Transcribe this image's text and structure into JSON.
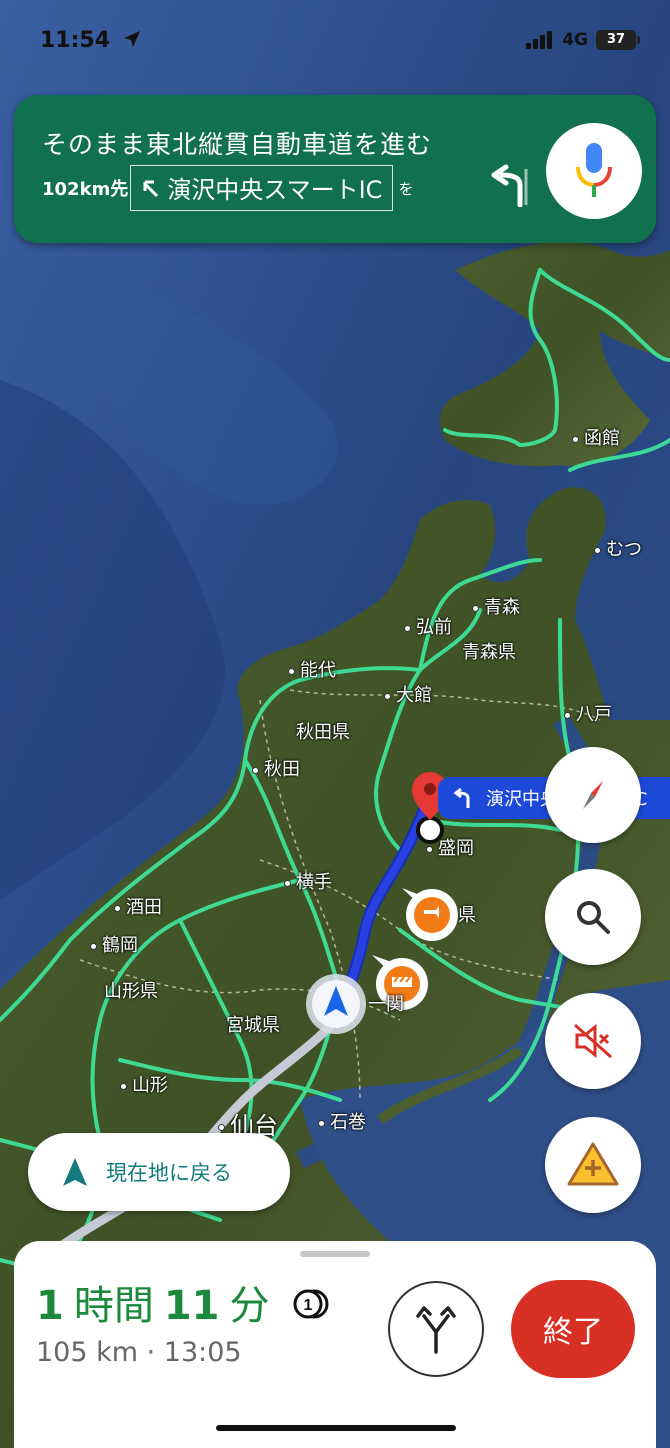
{
  "status_bar": {
    "time": "11:54",
    "network": "4G",
    "battery": "37"
  },
  "nav": {
    "instruction": "そのまま東北縦貫自動車道を進む",
    "distance": "102km先",
    "exit_name": "演沢中央スマートIC",
    "suffix": "を"
  },
  "destination_label": "演沢中央スマートIC",
  "map_places": {
    "hakodate": "函館",
    "mutsu": "むつ",
    "aomori": "青森",
    "hirosaki": "弘前",
    "aomori_pref": "青森県",
    "noshiro": "能代",
    "odate": "大館",
    "hachinohe": "八戸",
    "akita_pref": "秋田県",
    "akita": "秋田",
    "morioka": "盛岡",
    "yokote": "横手",
    "sakata": "酒田",
    "tsuruoka": "鶴岡",
    "iwate_pref_fragment": "県",
    "yamagata_pref": "山形県",
    "ichinoseki_fragment": "一関",
    "miyagi_pref": "宮城県",
    "yamagata": "山形",
    "sendai": "仙台",
    "ishinomaki": "石巻"
  },
  "recenter_label": "現在地に戻る",
  "sheet": {
    "hours": "1",
    "hours_unit": "時間",
    "minutes": "11",
    "minutes_unit": "分",
    "alternates_badge": "1",
    "distance_eta": "105 km · 13:05",
    "end_label": "終了"
  },
  "colors": {
    "nav_green": "#11704d",
    "route_blue": "#2a3fe0",
    "highway_green": "#3ee29a",
    "end_red": "#d93025",
    "eta_green": "#1b8a3c"
  }
}
